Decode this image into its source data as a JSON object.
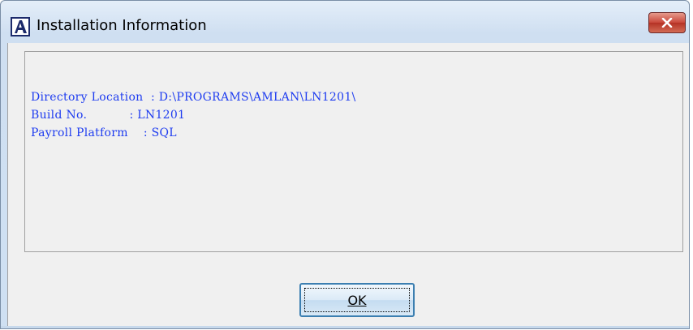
{
  "window": {
    "title": "Installation Information",
    "icon": "app-logo-a-icon",
    "close_icon": "close-icon"
  },
  "info": {
    "rows": [
      {
        "label": "Directory Location",
        "value": "D:\\PROGRAMS\\AMLAN\\LN1201\\"
      },
      {
        "label": "Build No.",
        "value": "LN1201"
      },
      {
        "label": "Payroll Platform",
        "value": "SQL"
      }
    ]
  },
  "buttons": {
    "ok_label": "OK"
  },
  "colors": {
    "text_blue": "#1e3cf0",
    "close_red": "#c9473a",
    "dialog_bg": "#f0f0f0"
  }
}
